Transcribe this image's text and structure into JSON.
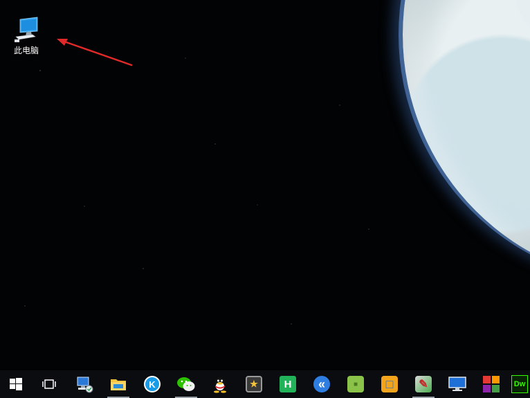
{
  "desktop": {
    "icons": [
      {
        "label": "此电脑",
        "icon": "this-pc-icon"
      }
    ],
    "annotation": {
      "type": "arrow",
      "color": "#e02a2a",
      "points_to": "此电脑"
    }
  },
  "taskbar": {
    "items": [
      {
        "name": "start",
        "icon": "windows-logo-icon",
        "running": false
      },
      {
        "name": "task-view",
        "icon": "task-view-icon",
        "running": false
      },
      {
        "name": "network-setup",
        "icon": "network-computer-icon",
        "running": false
      },
      {
        "name": "file-explorer",
        "icon": "folder-icon",
        "running": true
      },
      {
        "name": "kugou-music",
        "icon": "kugou-icon",
        "glyph": "K",
        "color": "#1a9be8",
        "running": false
      },
      {
        "name": "wechat",
        "icon": "wechat-icon",
        "color": "#2dc100",
        "running": true
      },
      {
        "name": "qq",
        "icon": "qq-penguin-icon",
        "running": false
      },
      {
        "name": "app-star",
        "icon": "star-box-icon",
        "glyph": "★",
        "color": "#3a3a3a",
        "running": false
      },
      {
        "name": "hbuilder",
        "icon": "hbuilder-icon",
        "glyph": "H",
        "color": "#21b25a",
        "running": false
      },
      {
        "name": "app-blue-k",
        "icon": "blue-chevron-icon",
        "glyph": "«",
        "color": "#2e7de0",
        "running": false
      },
      {
        "name": "app-green",
        "icon": "green-box-icon",
        "glyph": "■",
        "color": "#8bc34a",
        "running": false
      },
      {
        "name": "app-square",
        "icon": "blue-orange-square-icon",
        "glyph": "□",
        "color": "#f2a41c",
        "running": false
      },
      {
        "name": "app-pen",
        "icon": "pen-globe-icon",
        "glyph": "✎",
        "color": "#4caf50",
        "running": true
      },
      {
        "name": "remote-desktop",
        "icon": "monitor-icon",
        "running": false
      },
      {
        "name": "app-grid",
        "icon": "color-grid-icon",
        "running": false
      },
      {
        "name": "dreamweaver",
        "icon": "dreamweaver-icon",
        "glyph": "Dw",
        "color": "#35fa00",
        "running": false
      }
    ]
  }
}
